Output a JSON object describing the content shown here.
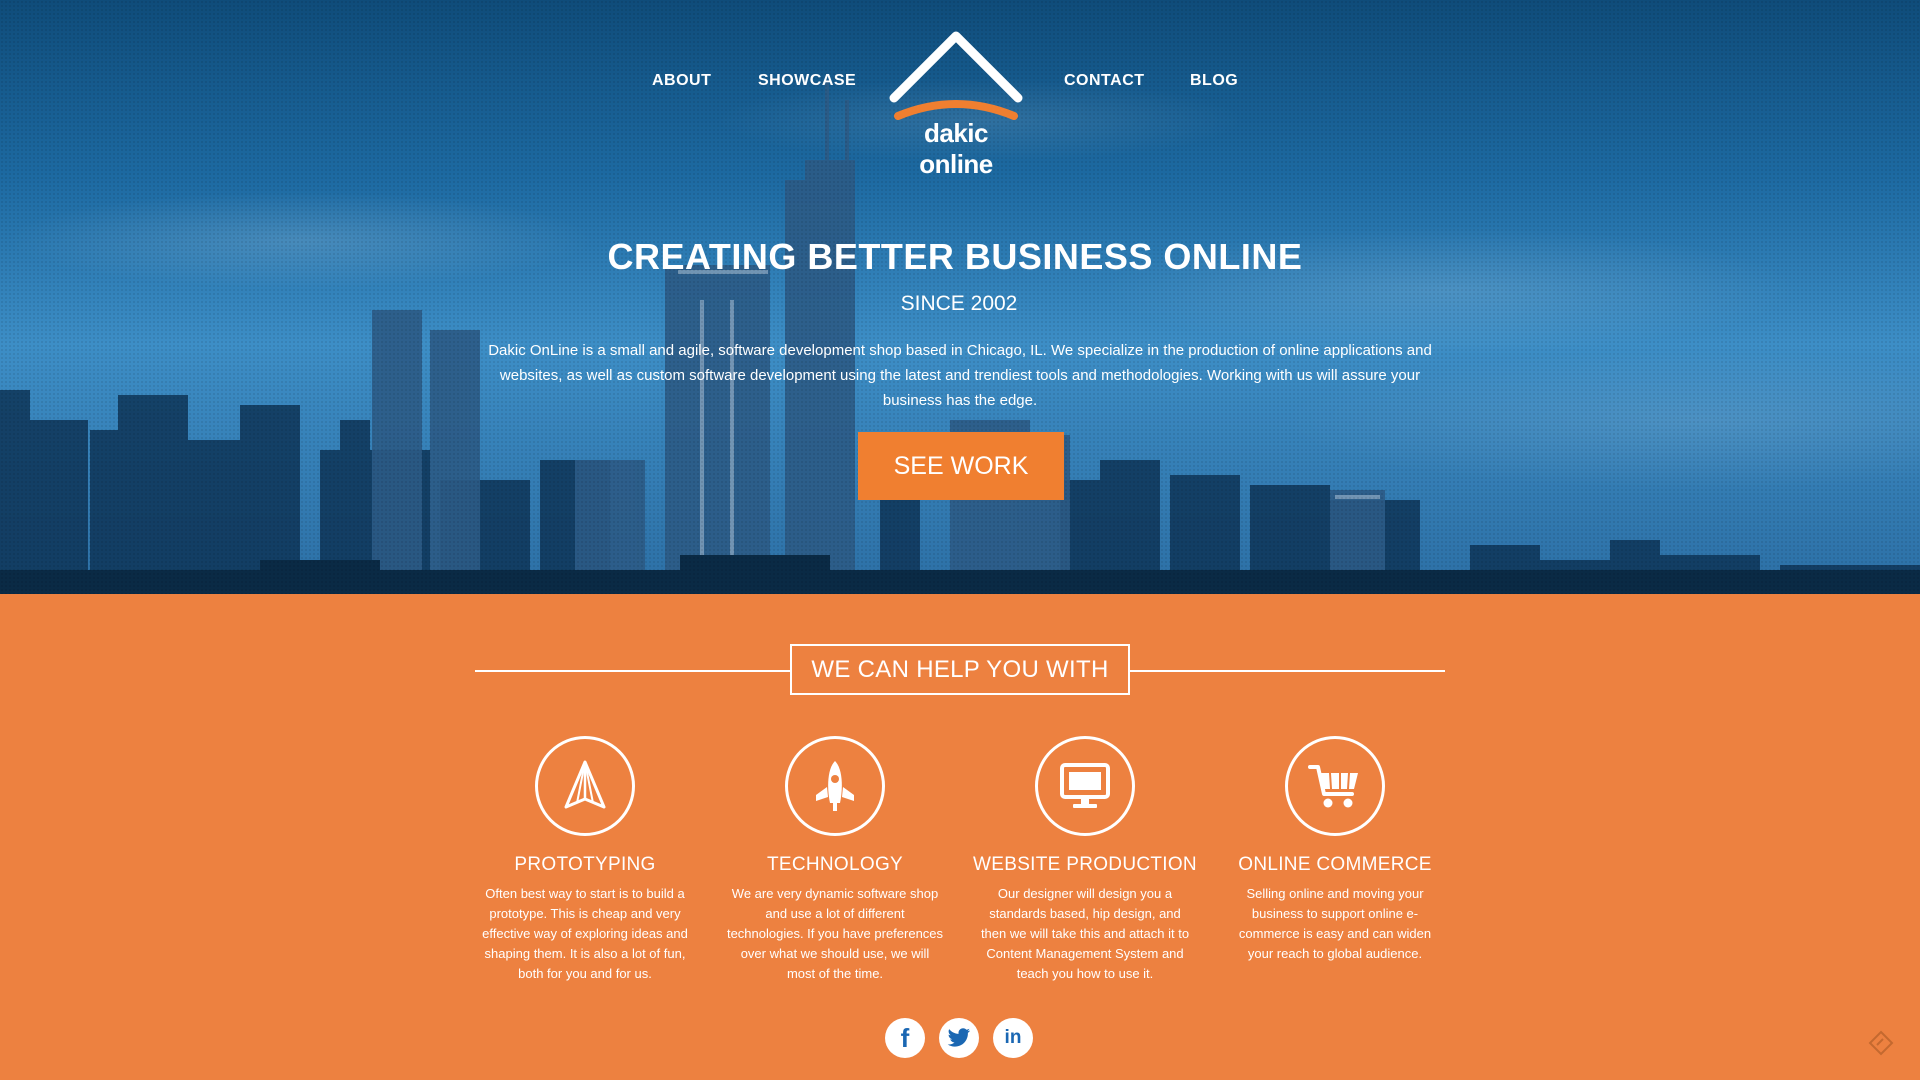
{
  "nav": {
    "about": "ABOUT",
    "showcase": "SHOWCASE",
    "contact": "CONTACT",
    "blog": "BLOG"
  },
  "logo": {
    "text": "dakic online"
  },
  "hero": {
    "headline": "CREATING BETTER BUSINESS ONLINE",
    "since": "SINCE 2002",
    "intro": "Dakic OnLine is a small and agile, software development shop based in Chicago, IL. We specialize in the production of online applications and websites, as well as custom software development using the latest and trendiest tools and methodologies. Working with us will assure your business has the edge.",
    "cta": "SEE WORK"
  },
  "services": {
    "heading": "WE CAN HELP YOU WITH",
    "items": [
      {
        "icon": "paper-plane-icon",
        "title": "PROTOTYPING",
        "text": "Often best way to start is to build a prototype. This is cheap and very effective way of exploring ideas and shaping them. It is also a lot of fun, both for you and for us."
      },
      {
        "icon": "rocket-icon",
        "title": "TECHNOLOGY",
        "text": "We are very dynamic software shop and use a lot of different technologies. If you have preferences over what we should use, we will most of the time."
      },
      {
        "icon": "monitor-icon",
        "title": "WEBSITE PRODUCTION",
        "text": "Our designer will design you a standards based, hip design, and then we will take this and attach it to Content Management System and teach you how to use it."
      },
      {
        "icon": "shopping-cart-icon",
        "title": "ONLINE COMMERCE",
        "text": "Selling online and moving your business to support online e-commerce is easy and can widen your reach to global audience."
      }
    ]
  },
  "social": {
    "facebook": "f",
    "twitter": "twitter-icon",
    "linkedin": "in"
  },
  "colors": {
    "orange": "#ed8140",
    "button_orange": "#f07f30",
    "sky_blue": "#1d6aa2",
    "social_blue": "#1a67b3"
  }
}
